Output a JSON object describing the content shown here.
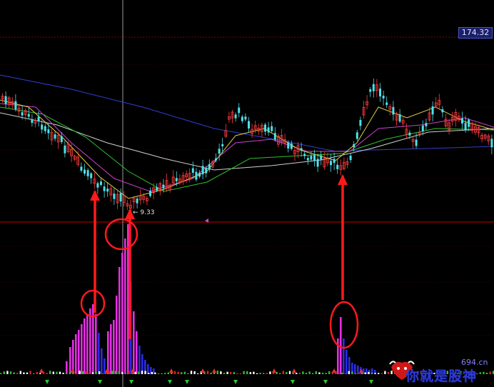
{
  "header": {
    "price_level": "174.32"
  },
  "annotations": {
    "low_price": "9.33"
  },
  "watermark": {
    "site": "694.cn",
    "text": "你就是股神"
  },
  "colors": {
    "background": "#000000",
    "candle_up": "#ff3b3b",
    "candle_down": "#4fe0e8",
    "volume_magenta": "#e62ee6",
    "volume_blue": "#2c2ce6",
    "ma_white": "#d0d0d0",
    "ma_yellow": "#e0d040",
    "ma_magenta": "#d040d0",
    "ma_green": "#30c030",
    "ma_blue": "#3040d0",
    "annotation": "#ff1a1a",
    "grid": "#7a0000"
  },
  "chart_data": {
    "type": "candlestick",
    "panels": [
      "price",
      "indicator"
    ],
    "price_level_line": 174.32,
    "marked_low": 9.33,
    "annotations": [
      "circle-and-arrow signal at first volume cluster",
      "circle-and-arrow signal at peak volume bar",
      "circle-and-arrow signal at right volume spike"
    ]
  }
}
